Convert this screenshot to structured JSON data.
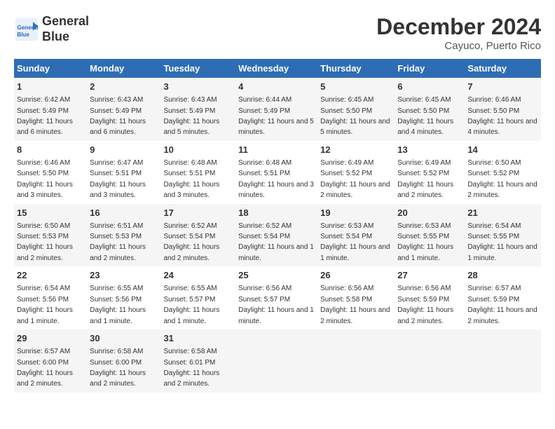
{
  "header": {
    "logo_line1": "General",
    "logo_line2": "Blue",
    "title": "December 2024",
    "location": "Cayuco, Puerto Rico"
  },
  "columns": [
    "Sunday",
    "Monday",
    "Tuesday",
    "Wednesday",
    "Thursday",
    "Friday",
    "Saturday"
  ],
  "weeks": [
    [
      {
        "day": "1",
        "sunrise": "6:42 AM",
        "sunset": "5:49 PM",
        "daylight": "11 hours and 6 minutes."
      },
      {
        "day": "2",
        "sunrise": "6:43 AM",
        "sunset": "5:49 PM",
        "daylight": "11 hours and 6 minutes."
      },
      {
        "day": "3",
        "sunrise": "6:43 AM",
        "sunset": "5:49 PM",
        "daylight": "11 hours and 5 minutes."
      },
      {
        "day": "4",
        "sunrise": "6:44 AM",
        "sunset": "5:49 PM",
        "daylight": "11 hours and 5 minutes."
      },
      {
        "day": "5",
        "sunrise": "6:45 AM",
        "sunset": "5:50 PM",
        "daylight": "11 hours and 5 minutes."
      },
      {
        "day": "6",
        "sunrise": "6:45 AM",
        "sunset": "5:50 PM",
        "daylight": "11 hours and 4 minutes."
      },
      {
        "day": "7",
        "sunrise": "6:46 AM",
        "sunset": "5:50 PM",
        "daylight": "11 hours and 4 minutes."
      }
    ],
    [
      {
        "day": "8",
        "sunrise": "6:46 AM",
        "sunset": "5:50 PM",
        "daylight": "11 hours and 3 minutes."
      },
      {
        "day": "9",
        "sunrise": "6:47 AM",
        "sunset": "5:51 PM",
        "daylight": "11 hours and 3 minutes."
      },
      {
        "day": "10",
        "sunrise": "6:48 AM",
        "sunset": "5:51 PM",
        "daylight": "11 hours and 3 minutes."
      },
      {
        "day": "11",
        "sunrise": "6:48 AM",
        "sunset": "5:51 PM",
        "daylight": "11 hours and 3 minutes."
      },
      {
        "day": "12",
        "sunrise": "6:49 AM",
        "sunset": "5:52 PM",
        "daylight": "11 hours and 2 minutes."
      },
      {
        "day": "13",
        "sunrise": "6:49 AM",
        "sunset": "5:52 PM",
        "daylight": "11 hours and 2 minutes."
      },
      {
        "day": "14",
        "sunrise": "6:50 AM",
        "sunset": "5:52 PM",
        "daylight": "11 hours and 2 minutes."
      }
    ],
    [
      {
        "day": "15",
        "sunrise": "6:50 AM",
        "sunset": "5:53 PM",
        "daylight": "11 hours and 2 minutes."
      },
      {
        "day": "16",
        "sunrise": "6:51 AM",
        "sunset": "5:53 PM",
        "daylight": "11 hours and 2 minutes."
      },
      {
        "day": "17",
        "sunrise": "6:52 AM",
        "sunset": "5:54 PM",
        "daylight": "11 hours and 2 minutes."
      },
      {
        "day": "18",
        "sunrise": "6:52 AM",
        "sunset": "5:54 PM",
        "daylight": "11 hours and 1 minute."
      },
      {
        "day": "19",
        "sunrise": "6:53 AM",
        "sunset": "5:54 PM",
        "daylight": "11 hours and 1 minute."
      },
      {
        "day": "20",
        "sunrise": "6:53 AM",
        "sunset": "5:55 PM",
        "daylight": "11 hours and 1 minute."
      },
      {
        "day": "21",
        "sunrise": "6:54 AM",
        "sunset": "5:55 PM",
        "daylight": "11 hours and 1 minute."
      }
    ],
    [
      {
        "day": "22",
        "sunrise": "6:54 AM",
        "sunset": "5:56 PM",
        "daylight": "11 hours and 1 minute."
      },
      {
        "day": "23",
        "sunrise": "6:55 AM",
        "sunset": "5:56 PM",
        "daylight": "11 hours and 1 minute."
      },
      {
        "day": "24",
        "sunrise": "6:55 AM",
        "sunset": "5:57 PM",
        "daylight": "11 hours and 1 minute."
      },
      {
        "day": "25",
        "sunrise": "6:56 AM",
        "sunset": "5:57 PM",
        "daylight": "11 hours and 1 minute."
      },
      {
        "day": "26",
        "sunrise": "6:56 AM",
        "sunset": "5:58 PM",
        "daylight": "11 hours and 2 minutes."
      },
      {
        "day": "27",
        "sunrise": "6:56 AM",
        "sunset": "5:59 PM",
        "daylight": "11 hours and 2 minutes."
      },
      {
        "day": "28",
        "sunrise": "6:57 AM",
        "sunset": "5:59 PM",
        "daylight": "11 hours and 2 minutes."
      }
    ],
    [
      {
        "day": "29",
        "sunrise": "6:57 AM",
        "sunset": "6:00 PM",
        "daylight": "11 hours and 2 minutes."
      },
      {
        "day": "30",
        "sunrise": "6:58 AM",
        "sunset": "6:00 PM",
        "daylight": "11 hours and 2 minutes."
      },
      {
        "day": "31",
        "sunrise": "6:58 AM",
        "sunset": "6:01 PM",
        "daylight": "11 hours and 2 minutes."
      },
      null,
      null,
      null,
      null
    ]
  ],
  "labels": {
    "sunrise_prefix": "Sunrise: ",
    "sunset_prefix": "Sunset: ",
    "daylight_prefix": "Daylight: "
  }
}
